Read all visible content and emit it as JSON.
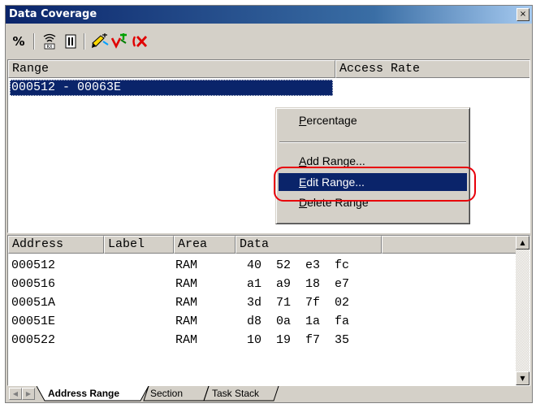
{
  "window": {
    "title": "Data Coverage",
    "close_glyph": "×"
  },
  "toolbar": {
    "buttons": [
      {
        "name": "percentage-icon",
        "glyph": "%"
      },
      {
        "name": "coverage-settings-icon"
      },
      {
        "name": "clear-icon"
      },
      {
        "name": "edit-range-icon"
      },
      {
        "name": "add-range-icon"
      },
      {
        "name": "delete-range-icon"
      }
    ]
  },
  "range_table": {
    "columns": [
      "Range",
      "Access Rate"
    ],
    "rows": [
      {
        "range": "000512 - 00063E",
        "access_rate": ""
      }
    ]
  },
  "context_menu": {
    "items": [
      {
        "label": "Percentage",
        "mnemonic_index": 0
      },
      {
        "label": "Add Range...",
        "mnemonic_index": 0
      },
      {
        "label": "Edit Range...",
        "mnemonic_index": 0,
        "highlighted": true
      },
      {
        "label": "Delete Range",
        "mnemonic_index": 0
      }
    ]
  },
  "data_table": {
    "columns": [
      "Address",
      "Label",
      "Area",
      "Data"
    ],
    "rows": [
      {
        "address": "000512",
        "label": "",
        "area": "RAM",
        "data": "40  52  e3  fc"
      },
      {
        "address": "000516",
        "label": "",
        "area": "RAM",
        "data": "a1  a9  18  e7"
      },
      {
        "address": "00051A",
        "label": "",
        "area": "RAM",
        "data": "3d  71  7f  02"
      },
      {
        "address": "00051E",
        "label": "",
        "area": "RAM",
        "data": "d8  0a  1a  fa"
      },
      {
        "address": "000522",
        "label": "",
        "area": "RAM",
        "data": "10  19  f7  35"
      }
    ]
  },
  "tabs": {
    "items": [
      "Address Range",
      "Section",
      "Task Stack"
    ],
    "active": "Address Range"
  },
  "colors": {
    "selection": "#0a246a",
    "annotation": "#e8000a",
    "face": "#d4d0c8"
  }
}
